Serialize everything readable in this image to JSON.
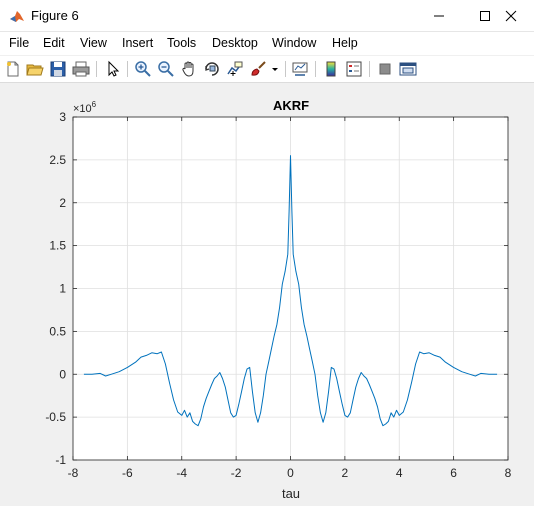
{
  "window": {
    "title": "Figure 6",
    "minimize_glyph": "—",
    "maximize_glyph": "☐",
    "close_glyph": "✕"
  },
  "menu": {
    "items": [
      "File",
      "Edit",
      "View",
      "Insert",
      "Tools",
      "Desktop",
      "Window",
      "Help"
    ]
  },
  "toolbar": {
    "icons": [
      "new-figure-icon",
      "open-file-icon",
      "save-icon",
      "print-icon",
      "pointer-icon",
      "zoom-in-icon",
      "zoom-out-icon",
      "pan-hand-icon",
      "rotate-3d-icon",
      "data-cursor-icon",
      "brush-icon",
      "brush-dropdown-icon",
      "link-plot-icon",
      "colorbar-icon",
      "legend-icon",
      "hide-plot-tools-icon",
      "show-plot-tools-icon"
    ]
  },
  "chart_data": {
    "type": "line",
    "title": "AKRF",
    "xlabel": "tau",
    "ylabel": "",
    "y_exponent_label": "× 10^6",
    "y_exponent_base": "×10",
    "y_exponent_power": "6",
    "xlim": [
      -8,
      8
    ],
    "ylim": [
      -1,
      3
    ],
    "xticks": [
      -8,
      -6,
      -4,
      -2,
      0,
      2,
      4,
      6,
      8
    ],
    "yticks": [
      -1,
      -0.5,
      0,
      0.5,
      1,
      1.5,
      2,
      2.5,
      3
    ],
    "xtick_labels": [
      "-8",
      "-6",
      "-4",
      "-2",
      "0",
      "2",
      "4",
      "6",
      "8"
    ],
    "ytick_labels": [
      "-1",
      "-0.5",
      "0",
      "0.5",
      "1",
      "1.5",
      "2",
      "2.5",
      "3"
    ],
    "grid": true,
    "line_color": "#0072bd",
    "series": [
      {
        "x": [
          -7.6,
          -7.3,
          -7.0,
          -6.8,
          -6.6,
          -6.3,
          -6.0,
          -5.7,
          -5.5,
          -5.3,
          -5.1,
          -4.9,
          -4.75,
          -4.6,
          -4.45,
          -4.3,
          -4.15,
          -4.0,
          -3.9,
          -3.8,
          -3.7,
          -3.6,
          -3.5,
          -3.4,
          -3.3,
          -3.2,
          -3.1,
          -3.0,
          -2.9,
          -2.8,
          -2.7,
          -2.6,
          -2.5,
          -2.4,
          -2.3,
          -2.2,
          -2.1,
          -2.0,
          -1.9,
          -1.8,
          -1.7,
          -1.6,
          -1.5,
          -1.4,
          -1.3,
          -1.2,
          -1.1,
          -1.0,
          -0.9,
          -0.8,
          -0.7,
          -0.6,
          -0.5,
          -0.4,
          -0.3,
          -0.2,
          -0.1,
          -0.05,
          0,
          0.05,
          0.1,
          0.2,
          0.3,
          0.4,
          0.5,
          0.6,
          0.7,
          0.8,
          0.9,
          1.0,
          1.1,
          1.2,
          1.3,
          1.4,
          1.5,
          1.6,
          1.7,
          1.8,
          1.9,
          2.0,
          2.1,
          2.2,
          2.3,
          2.4,
          2.5,
          2.6,
          2.7,
          2.8,
          2.9,
          3.0,
          3.1,
          3.2,
          3.3,
          3.4,
          3.5,
          3.6,
          3.7,
          3.8,
          3.9,
          4.0,
          4.15,
          4.3,
          4.45,
          4.6,
          4.75,
          4.9,
          5.1,
          5.3,
          5.5,
          5.7,
          6.0,
          6.3,
          6.6,
          6.8,
          7.0,
          7.3,
          7.6
        ],
        "y": [
          0.0,
          0.0,
          0.01,
          -0.02,
          0.0,
          0.03,
          0.08,
          0.14,
          0.2,
          0.22,
          0.25,
          0.24,
          0.26,
          0.12,
          -0.1,
          -0.3,
          -0.44,
          -0.48,
          -0.42,
          -0.5,
          -0.45,
          -0.55,
          -0.58,
          -0.6,
          -0.52,
          -0.38,
          -0.28,
          -0.2,
          -0.12,
          -0.05,
          -0.02,
          0.02,
          -0.05,
          -0.15,
          -0.3,
          -0.45,
          -0.5,
          -0.48,
          -0.35,
          -0.2,
          -0.05,
          0.06,
          0.08,
          -0.2,
          -0.45,
          -0.56,
          -0.45,
          -0.25,
          0.0,
          0.15,
          0.3,
          0.45,
          0.58,
          0.78,
          1.05,
          1.2,
          1.4,
          1.9,
          2.55,
          1.9,
          1.4,
          1.2,
          1.05,
          0.78,
          0.58,
          0.45,
          0.3,
          0.15,
          0.0,
          -0.25,
          -0.45,
          -0.56,
          -0.45,
          -0.2,
          0.08,
          0.06,
          -0.05,
          -0.2,
          -0.35,
          -0.48,
          -0.5,
          -0.45,
          -0.3,
          -0.15,
          -0.05,
          0.02,
          -0.02,
          -0.05,
          -0.12,
          -0.2,
          -0.28,
          -0.38,
          -0.52,
          -0.6,
          -0.58,
          -0.55,
          -0.45,
          -0.5,
          -0.42,
          -0.48,
          -0.44,
          -0.3,
          -0.1,
          0.12,
          0.26,
          0.24,
          0.25,
          0.22,
          0.2,
          0.14,
          0.08,
          0.03,
          0.0,
          -0.02,
          0.01,
          0.0,
          0.0
        ]
      }
    ]
  }
}
